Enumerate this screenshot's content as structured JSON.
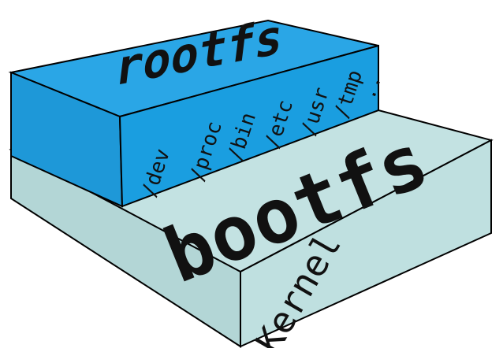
{
  "diagram": {
    "upper_block": {
      "top_label": "rootfs",
      "dirs": [
        "/dev",
        "/proc",
        "/bin",
        "/etc",
        "/usr",
        "/tmp",
        ".."
      ],
      "color": "#1a9ee0"
    },
    "lower_block": {
      "top_label": "bootfs",
      "front_label": "Kernel",
      "color": "#bfe0e0"
    }
  }
}
